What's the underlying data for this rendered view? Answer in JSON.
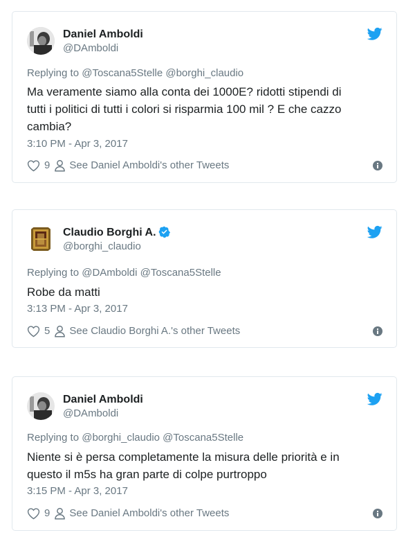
{
  "colors": {
    "twitter_blue": "#1da1f2",
    "text_primary": "#1c2022",
    "text_secondary": "#697882",
    "border": "#e1e8ed"
  },
  "tweets": [
    {
      "display_name": "Daniel Amboldi",
      "handle": "@DAmboldi",
      "verified": false,
      "avatar_icon": "avatar-photo",
      "reply_line": "Replying to @Toscana5Stelle @borghi_claudio",
      "text_lines": [
        "Ma veramente siamo alla conta dei 1000E?  ridotti stipendi di",
        "tutti i politici di tutti i colori si risparmia 100 mil ? E che cazzo",
        "cambia?"
      ],
      "timestamp": "3:10 PM - Apr 3, 2017",
      "likes": "9",
      "other_tweets": "See Daniel Amboldi's other Tweets"
    },
    {
      "display_name": "Claudio Borghi A.",
      "handle": "@borghi_claudio",
      "verified": true,
      "avatar_icon": "avatar-photo",
      "reply_line": "Replying to @DAmboldi @Toscana5Stelle",
      "text_lines": [
        "Robe da matti"
      ],
      "timestamp": "3:13 PM - Apr 3, 2017",
      "likes": "5",
      "other_tweets": "See Claudio Borghi A.'s other Tweets"
    },
    {
      "display_name": "Daniel Amboldi",
      "handle": "@DAmboldi",
      "verified": false,
      "avatar_icon": "avatar-photo",
      "reply_line": "Replying to @borghi_claudio @Toscana5Stelle",
      "text_lines": [
        "Niente si è persa completamente la misura delle priorità e in",
        "questo il m5s ha gran parte di colpe purtroppo"
      ],
      "timestamp": "3:15 PM - Apr 3, 2017",
      "likes": "9",
      "other_tweets": "See Daniel Amboldi's other Tweets"
    }
  ]
}
